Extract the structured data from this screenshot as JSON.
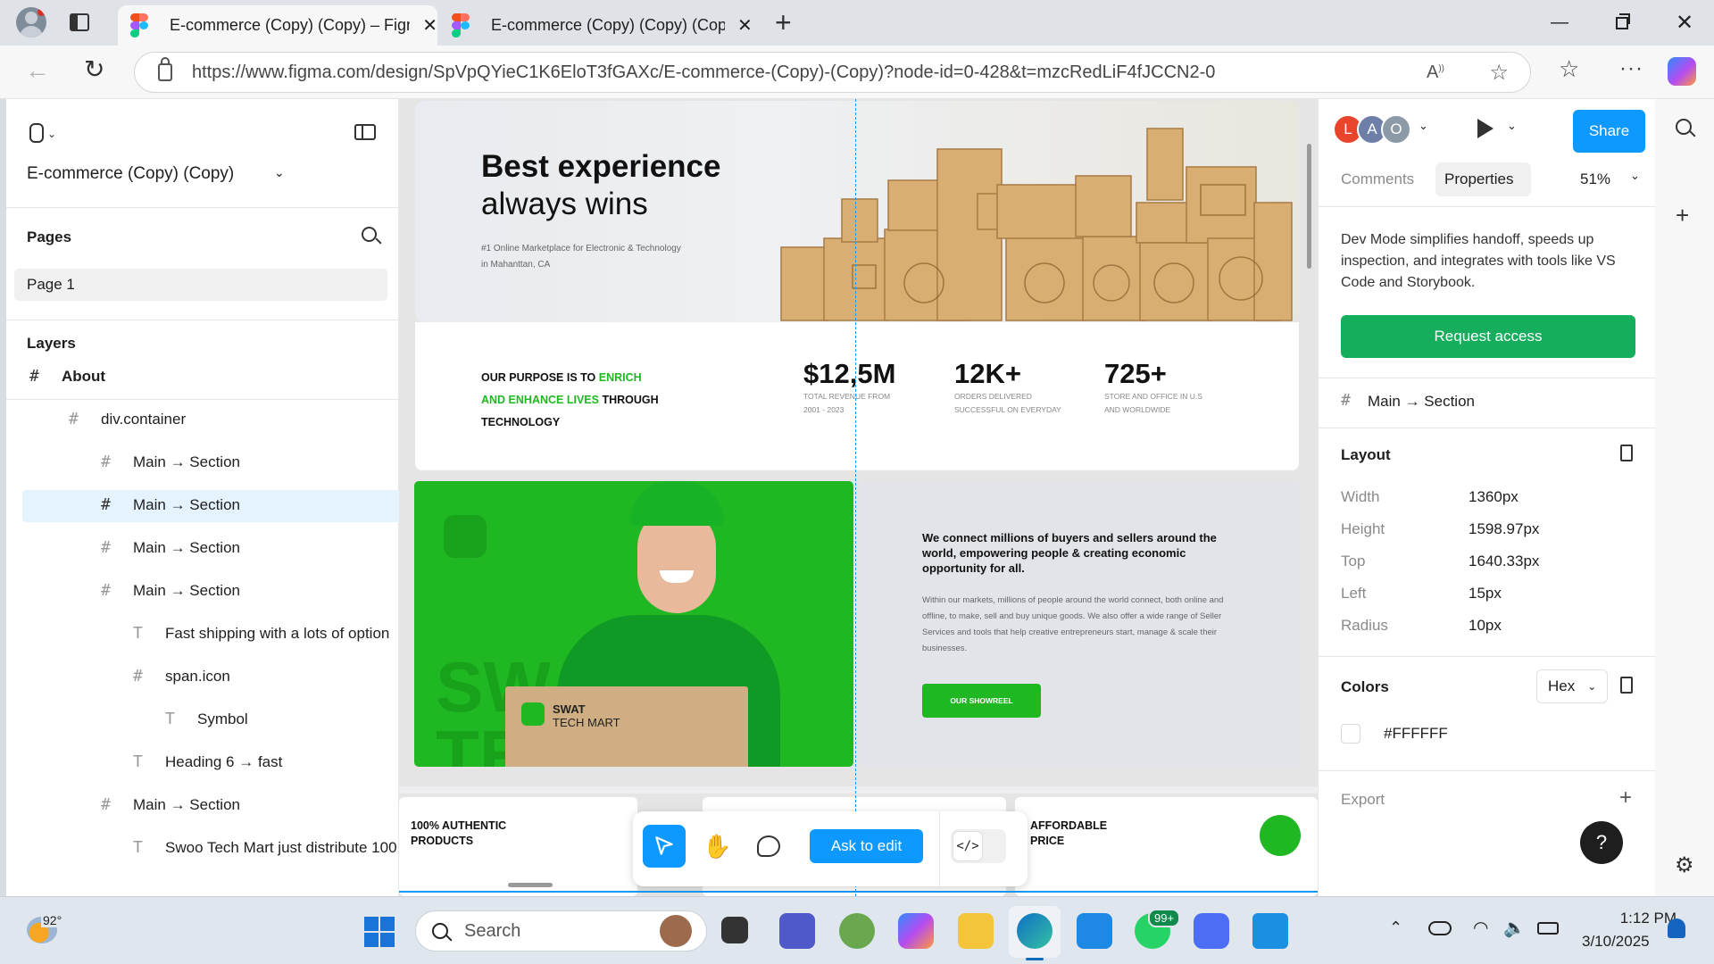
{
  "browser": {
    "tabs": [
      {
        "title": "E-commerce (Copy) (Copy) – Figma",
        "active": true
      },
      {
        "title": "E-commerce (Copy) (Copy) (Copy)",
        "active": false
      }
    ],
    "url": "https://www.figma.com/design/SpVpQYieC1K6EloT3fGAXc/E-commerce-(Copy)-(Copy)?node-id=0-428&t=mzcRedLiF4fJCCN2-0"
  },
  "left_panel": {
    "file_name": "E-commerce (Copy) (Copy)",
    "pages_label": "Pages",
    "page1": "Page 1",
    "layers_label": "Layers",
    "layers": [
      {
        "label": "About",
        "kind": "frame",
        "indent": 0
      },
      {
        "label": "div.container",
        "kind": "frame",
        "indent": 1
      },
      {
        "label": "Main → Section",
        "kind": "frame",
        "indent": 2
      },
      {
        "label": "Main → Section",
        "kind": "frame",
        "indent": 2,
        "selected": true
      },
      {
        "label": "Main → Section",
        "kind": "frame",
        "indent": 2
      },
      {
        "label": "Main → Section",
        "kind": "frame",
        "indent": 2
      },
      {
        "label": "Fast shipping with a lots of option",
        "kind": "text",
        "indent": 3
      },
      {
        "label": "span.icon",
        "kind": "frame",
        "indent": 3
      },
      {
        "label": "Symbol",
        "kind": "text",
        "indent": 4
      },
      {
        "label": "Heading 6 → fast",
        "kind": "text",
        "indent": 3
      },
      {
        "label": "Main → Section",
        "kind": "frame",
        "indent": 2
      },
      {
        "label": "Swoo Tech Mart just distribute 100",
        "kind": "text",
        "indent": 3
      }
    ]
  },
  "canvas": {
    "hero": {
      "title_bold": "Best experience",
      "title_light": "always wins",
      "sub1": "#1 Online Marketplace for Electronic & Technology",
      "sub2": "in Mahanttan, CA"
    },
    "purpose": {
      "p1": "OUR PURPOSE IS TO ",
      "p2": "ENRICH",
      "p3": "AND ENHANCE LIVES",
      "p4": " THROUGH",
      "p5": "TECHNOLOGY"
    },
    "stats": [
      {
        "value": "$12,5M",
        "l1": "TOTAL REVENUE FROM",
        "l2": "2001 - 2023"
      },
      {
        "value": "12K+",
        "l1": "ORDERS DELIVERED",
        "l2": "SUCCESSFUL ON EVERYDAY"
      },
      {
        "value": "725+",
        "l1": "STORE AND OFFICE IN U.S",
        "l2": "AND WORLDWIDE"
      }
    ],
    "promo": {
      "bg_text1": "SW",
      "bg_text2": "TE",
      "brand1": "SWAT",
      "brand2": "TECH MART",
      "heading": "We connect millions of buyers and sellers around the world, empowering people & creating economic opportunity for all.",
      "body": "Within our markets, millions of people around the world connect, both online and offline, to make, sell and buy unique goods. We also offer a wide range of Seller Services and tools that help creative entrepreneurs start, manage & scale their businesses.",
      "button": "OUR SHOWREEL"
    },
    "features": [
      {
        "text": "100% AUTHENTIC PRODUCTS"
      },
      {
        "text": "AFFORDABLE PRICE"
      }
    ],
    "toolbar": {
      "ask": "Ask to edit"
    }
  },
  "right_panel": {
    "avatars": [
      "L",
      "A",
      "O"
    ],
    "share": "Share",
    "tab_comments": "Comments",
    "tab_properties": "Properties",
    "zoom": "51%",
    "devmode_text": "Dev Mode simplifies handoff, speeds up inspection, and integrates with tools like VS Code and Storybook.",
    "request": "Request access",
    "selection": "Main → Section",
    "layout_label": "Layout",
    "props": [
      {
        "label": "Width",
        "value": "1360px"
      },
      {
        "label": "Height",
        "value": "1598.97px"
      },
      {
        "label": "Top",
        "value": "1640.33px"
      },
      {
        "label": "Left",
        "value": "15px"
      },
      {
        "label": "Radius",
        "value": "10px"
      }
    ],
    "colors_label": "Colors",
    "color_format": "Hex",
    "color_value": "#FFFFFF",
    "export_label": "Export",
    "help": "?"
  },
  "taskbar": {
    "weather": "92°",
    "search": "Search",
    "badge": "99+",
    "time": "1:12 PM",
    "date": "3/10/2025"
  },
  "colors": {
    "figma_blue": "#0d99ff",
    "brand_green": "#1fb822",
    "request_green": "#14ae5c"
  }
}
